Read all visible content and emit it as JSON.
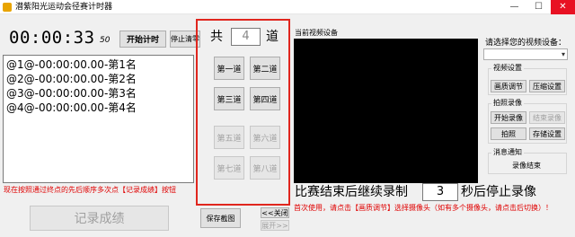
{
  "window": {
    "title": "潜紫阳光运动会径赛计时器",
    "controls": {
      "minimize": "—",
      "maximize": "☐",
      "close": "✕"
    }
  },
  "timer": {
    "display": "00:00:33",
    "fraction": "50"
  },
  "buttons": {
    "start": "开始计时",
    "stop_clear": "停止清零",
    "record": "记录成绩",
    "save_screenshot": "保存截图",
    "close_panel": "<<关闭",
    "expand": "展开>>"
  },
  "results": [
    "@1@-00:00:00.00-第1名",
    "@2@-00:00:00.00-第2名",
    "@3@-00:00:00.00-第3名",
    "@4@-00:00:00.00-第4名"
  ],
  "notes": {
    "left_hint": "现在按照通过终点的先后顺序多次点【记录成绩】按钮",
    "bottom_hint": "首次使用，请点击【画质调节】选择摄像头（如有多个摄像头，请点击后切换）！"
  },
  "lanes": {
    "prefix": "共",
    "count": "4",
    "suffix": "道",
    "items": [
      {
        "label": "第一道",
        "enabled": true
      },
      {
        "label": "第二道",
        "enabled": true
      },
      {
        "label": "第三道",
        "enabled": true
      },
      {
        "label": "第四道",
        "enabled": true
      },
      {
        "label": "第五道",
        "enabled": false
      },
      {
        "label": "第六道",
        "enabled": false
      },
      {
        "label": "第七道",
        "enabled": false
      },
      {
        "label": "第八道",
        "enabled": false
      }
    ]
  },
  "video": {
    "current_device_label": "当前视频设备",
    "select_device_label": "请选择您的视频设备：",
    "device_value": ""
  },
  "continue_record": {
    "text_before": "比赛结束后继续录制",
    "seconds": "3",
    "text_after": "秒后停止录像"
  },
  "settings": {
    "video_settings": {
      "legend": "视频设置",
      "quality": "画质调节",
      "compress": "压缩设置"
    },
    "capture": {
      "legend": "拍照录像",
      "start_record": "开始录像",
      "end_record": "结束录像",
      "photo": "拍照",
      "storage": "存储设置"
    },
    "message": {
      "legend": "消息通知",
      "text": "录像结束"
    }
  },
  "colors": {
    "highlight_frame": "#e0261e",
    "note_red": "#e00000",
    "preview_bg": "#000000"
  }
}
